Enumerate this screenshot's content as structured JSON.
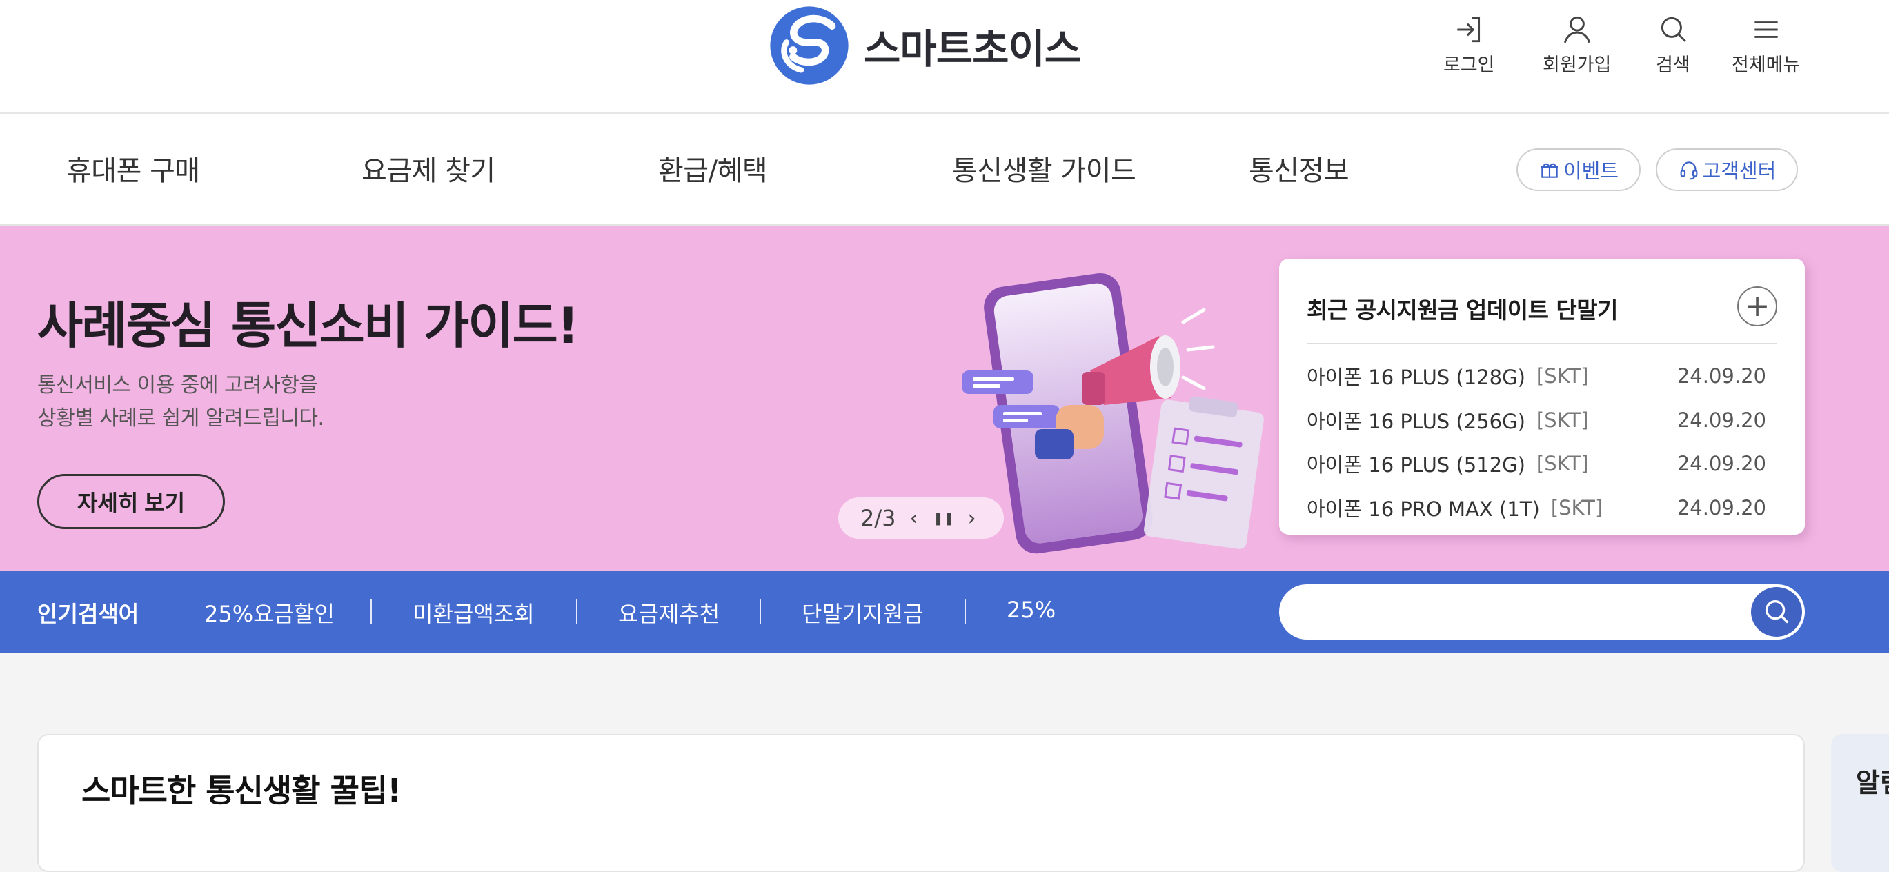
{
  "brand": {
    "name": "스마트초이스"
  },
  "utility_menu": [
    {
      "label": "로그인",
      "icon": "login-icon"
    },
    {
      "label": "회원가입",
      "icon": "user-icon"
    },
    {
      "label": "검색",
      "icon": "search-icon"
    },
    {
      "label": "전체메뉴",
      "icon": "hamburger-icon"
    }
  ],
  "gnb": {
    "items": [
      "휴대폰 구매",
      "요금제 찾기",
      "환급/혜택",
      "통신생활 가이드",
      "통신정보"
    ],
    "event_label": "이벤트",
    "support_label": "고객센터"
  },
  "hero": {
    "title": "사례중심 통신소비 가이드!",
    "description": "통신서비스 이용 중에 고려사항을\n상황별 사례로 쉽게 알려드립니다.",
    "button_label": "자세히 보기",
    "pager": {
      "current": "2/3",
      "prev": "‹",
      "pause": "❚❚",
      "next": "›"
    },
    "background": "#f2b5e3"
  },
  "update_panel": {
    "title": "최근 공시지원금 업데이트 단말기",
    "more_label": "+",
    "rows": [
      {
        "model": "아이폰 16 PLUS (128G)",
        "carrier": "[SKT]",
        "date": "24.09.20"
      },
      {
        "model": "아이폰 16 PLUS (256G)",
        "carrier": "[SKT]",
        "date": "24.09.20"
      },
      {
        "model": "아이폰 16 PLUS (512G)",
        "carrier": "[SKT]",
        "date": "24.09.20"
      },
      {
        "model": "아이폰 16 PRO MAX (1T)",
        "carrier": "[SKT]",
        "date": "24.09.20"
      }
    ]
  },
  "popular_search": {
    "label": "인기검색어",
    "keywords": [
      "25%요금할인",
      "미환급액조회",
      "요금제추천",
      "단말기지원금",
      "25%"
    ],
    "input_value": "",
    "accent": "#436bd0"
  },
  "content": {
    "title": "스마트한 통신생활 꿀팁!",
    "side_title": "알림"
  }
}
